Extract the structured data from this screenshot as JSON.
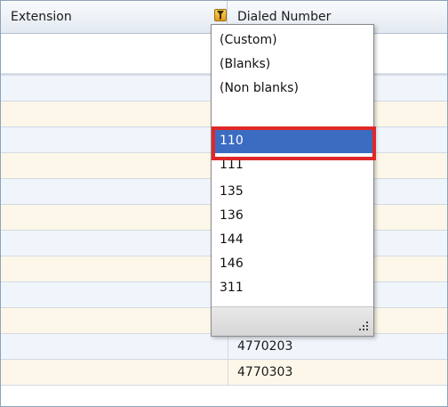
{
  "header": {
    "col_extension": "Extension",
    "col_dialed": "Dialed Number"
  },
  "filter_dropdown": {
    "items": [
      "(Custom)",
      "(Blanks)",
      "(Non blanks)",
      "",
      "110",
      "111",
      "135",
      "136",
      "144",
      "146",
      "311"
    ],
    "selected": "110"
  },
  "rows": [
    {
      "extension": "",
      "dialed": ""
    },
    {
      "extension": "",
      "dialed": ""
    },
    {
      "extension": "",
      "dialed": ""
    },
    {
      "extension": "",
      "dialed": ""
    },
    {
      "extension": "",
      "dialed": ""
    },
    {
      "extension": "",
      "dialed": ""
    },
    {
      "extension": "",
      "dialed": ""
    },
    {
      "extension": "",
      "dialed": ""
    },
    {
      "extension": "",
      "dialed": ""
    },
    {
      "extension": "",
      "dialed": ""
    },
    {
      "extension": "",
      "dialed": "4770203"
    },
    {
      "extension": "",
      "dialed": "4770303"
    }
  ],
  "colors": {
    "selection": "#3b6cc2",
    "highlight_border": "#e02727",
    "row_odd": "#f0f5fb",
    "row_even": "#fdf7ea"
  },
  "icons": {
    "filter": "filter-funnel-icon",
    "resize": "resize-grip-icon"
  }
}
